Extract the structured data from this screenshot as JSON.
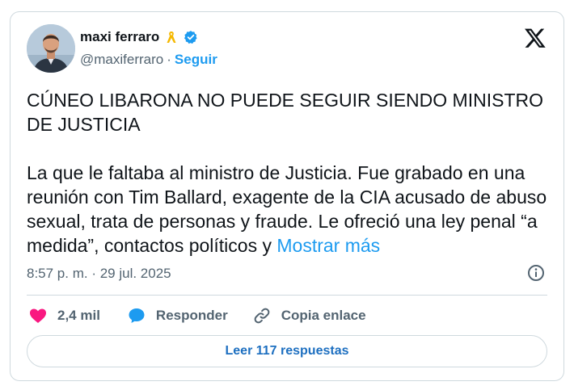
{
  "author": {
    "name": "maxi ferraro",
    "handle": "@maxiferraro",
    "separator": "·",
    "follow_label": "Seguir"
  },
  "tweet": {
    "paragraph1": "CÚNEO LIBARONA NO PUEDE SEGUIR SIENDO MINISTRO DE JUSTICIA",
    "paragraph2": "La que le faltaba al ministro de Justicia. Fue grabado en una reunión con Tim Ballard, exagente de la CIA acusado de abuso sexual, trata de personas y fraude. Le ofreció una ley penal “a medida”, contactos políticos y",
    "show_more": "Mostrar más",
    "timestamp": "8:57 p. m. · 29 jul. 2025"
  },
  "actions": {
    "likes_count": "2,4 mil",
    "reply_label": "Responder",
    "copy_link_label": "Copia enlace"
  },
  "read_replies_label": "Leer 117 respuestas",
  "icons": {
    "ribbon": "yellow-ribbon-icon",
    "verified": "verified-badge-icon",
    "logo": "x-logo-icon",
    "info": "info-icon",
    "like": "heart-icon",
    "reply": "speech-bubble-icon",
    "link": "link-icon"
  },
  "colors": {
    "accent": "#1d9bf0",
    "like": "#f91880",
    "ribbon": "#f5b800",
    "muted_text": "#536471",
    "border": "#cfd9de"
  }
}
